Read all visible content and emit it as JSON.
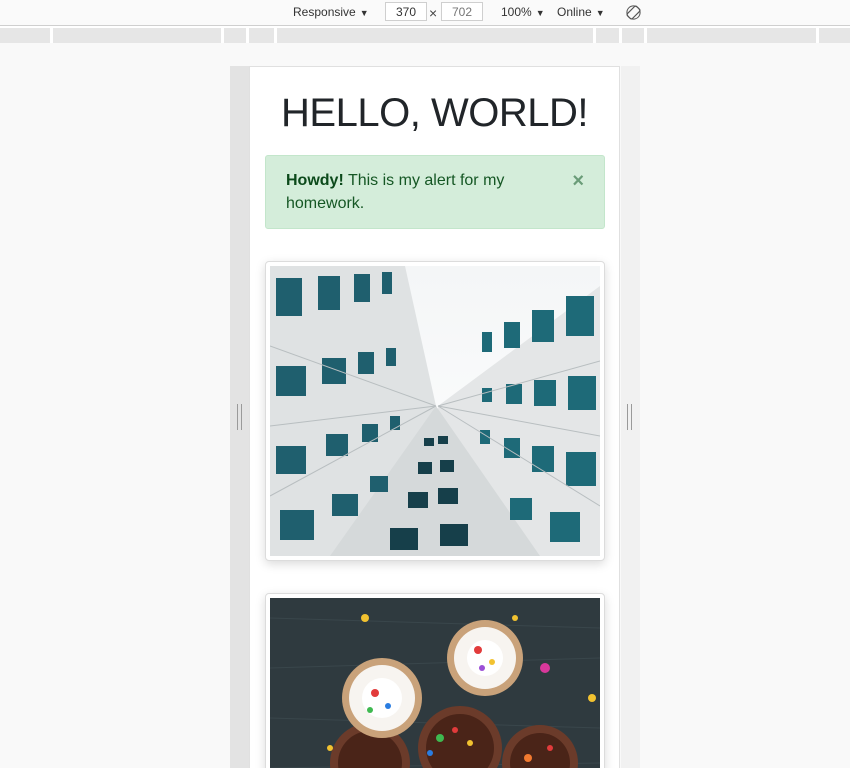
{
  "toolbar": {
    "device": "Responsive",
    "width": "370",
    "height_placeholder": "702",
    "times": "×",
    "zoom": "100%",
    "network": "Online",
    "rotate_icon": "rotate-icon"
  },
  "page": {
    "title": "HELLO, WORLD!",
    "alert": {
      "strong": "Howdy!",
      "text": " This is my alert for my homework.",
      "close": "×"
    }
  },
  "colors": {
    "alert_bg": "#d4edda",
    "alert_text": "#155724",
    "title": "#212529"
  }
}
